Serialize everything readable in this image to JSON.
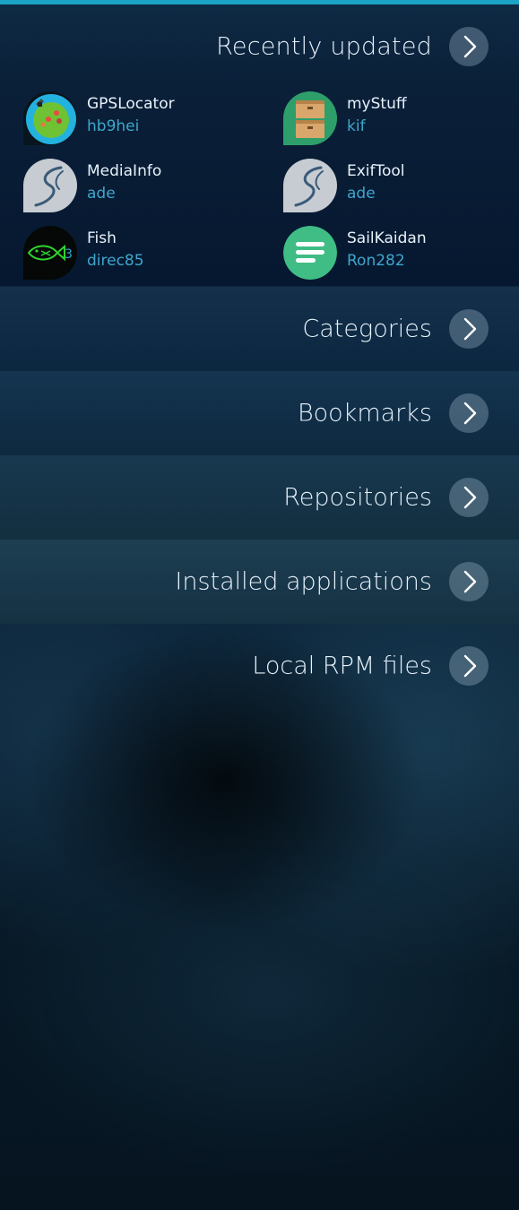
{
  "recent": {
    "title": "Recently updated",
    "apps": [
      {
        "name": "GPSLocator",
        "author": "hb9hei",
        "icon": "gps-locator-icon"
      },
      {
        "name": "myStuff",
        "author": "kif",
        "icon": "mystuff-boxes-icon"
      },
      {
        "name": "MediaInfo",
        "author": "ade",
        "icon": "sailfish-logo-icon"
      },
      {
        "name": "ExifTool",
        "author": "ade",
        "icon": "sailfish-logo-icon"
      },
      {
        "name": "Fish",
        "author": "direc85",
        "icon": "fish-icon"
      },
      {
        "name": "SailKaidan",
        "author": "Ron282",
        "icon": "chat-lines-icon"
      }
    ]
  },
  "nav": {
    "categories": "Categories",
    "bookmarks": "Bookmarks",
    "repositories": "Repositories",
    "installed": "Installed applications",
    "local_rpm": "Local RPM files"
  },
  "colors": {
    "accent": "#1aa3c4",
    "author_text": "#3fa6cc",
    "primary_text": "#e6f1fa"
  }
}
